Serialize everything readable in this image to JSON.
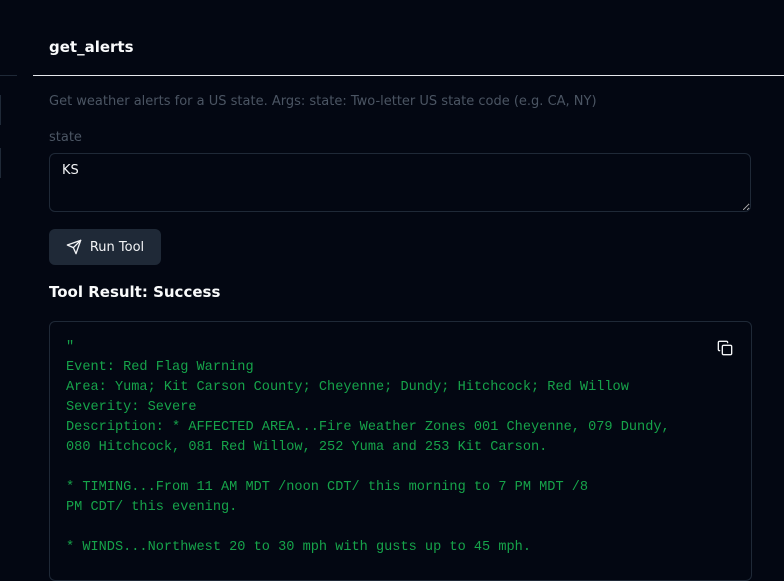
{
  "tool": {
    "name": "get_alerts",
    "description": "Get weather alerts for a US state. Args: state: Two-letter US state code (e.g. CA, NY)"
  },
  "form": {
    "state_label": "state",
    "state_value": "KS",
    "run_label": "Run Tool"
  },
  "result": {
    "heading": "Tool Result: Success",
    "text": "\"\nEvent: Red Flag Warning\nArea: Yuma; Kit Carson County; Cheyenne; Dundy; Hitchcock; Red Willow\nSeverity: Severe\nDescription: * AFFECTED AREA...Fire Weather Zones 001 Cheyenne, 079 Dundy,\n080 Hitchcock, 081 Red Willow, 252 Yuma and 253 Kit Carson.\n\n* TIMING...From 11 AM MDT /noon CDT/ this morning to 7 PM MDT /8\nPM CDT/ this evening.\n\n* WINDS...Northwest 20 to 30 mph with gusts up to 45 mph."
  }
}
